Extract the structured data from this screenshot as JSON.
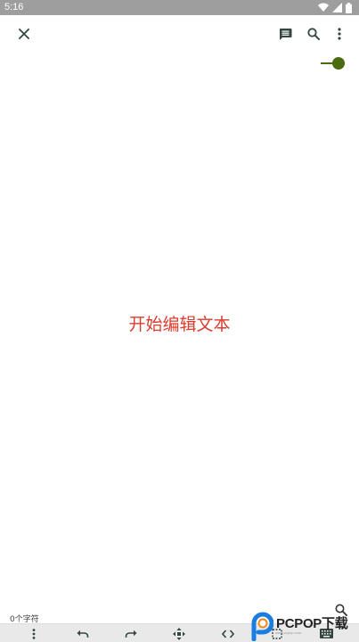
{
  "status_bar": {
    "time": "5:16",
    "icons": [
      "wifi-icon",
      "signal-icon",
      "battery-icon"
    ]
  },
  "toolbar": {
    "icons": [
      "close-icon",
      "comment-icon",
      "search-icon",
      "more-vert-icon"
    ]
  },
  "editor": {
    "hint": "开始编辑文本"
  },
  "footer": {
    "char_count": "0个字符",
    "find_icon": "search-icon"
  },
  "bottom_bar": {
    "icons": [
      "more-vert-icon",
      "undo-icon",
      "redo-icon",
      "move-icon",
      "code-icon",
      "select-icon",
      "keyboard-icon"
    ]
  },
  "watermark": {
    "brand": "PCPOP下载",
    "sub": "www.pcpop.com"
  },
  "colors": {
    "accent": "#4b6b10",
    "hint_text": "#d93d2e",
    "status_bar": "#9e9e9e",
    "toolbar_icon": "#33463f",
    "bottom_bar": "#e9e9e9"
  }
}
